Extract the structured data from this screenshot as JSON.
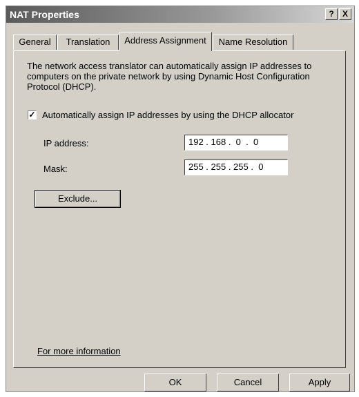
{
  "window": {
    "title": "NAT Properties",
    "help_button": "?",
    "close_button": "X"
  },
  "tabs": [
    {
      "label": "General",
      "active": false
    },
    {
      "label": "Translation",
      "active": false
    },
    {
      "label": "Address Assignment",
      "active": true
    },
    {
      "label": "Name Resolution",
      "active": false
    }
  ],
  "panel": {
    "description": "The network access translator can automatically assign IP addresses to computers on the private network by using Dynamic Host Configuration Protocol (DHCP).",
    "dhcp_checkbox": {
      "checked": true,
      "mark": "✓",
      "label": "Automatically assign IP addresses by using the DHCP allocator"
    },
    "ip_address": {
      "label": "IP address:",
      "value": "192 . 168 .  0  .  0"
    },
    "mask": {
      "label": "Mask:",
      "value": "255 . 255 . 255 .  0"
    },
    "exclude_button": "Exclude...",
    "more_info_link": "For more information"
  },
  "footer": {
    "ok": "OK",
    "cancel": "Cancel",
    "apply": "Apply"
  }
}
